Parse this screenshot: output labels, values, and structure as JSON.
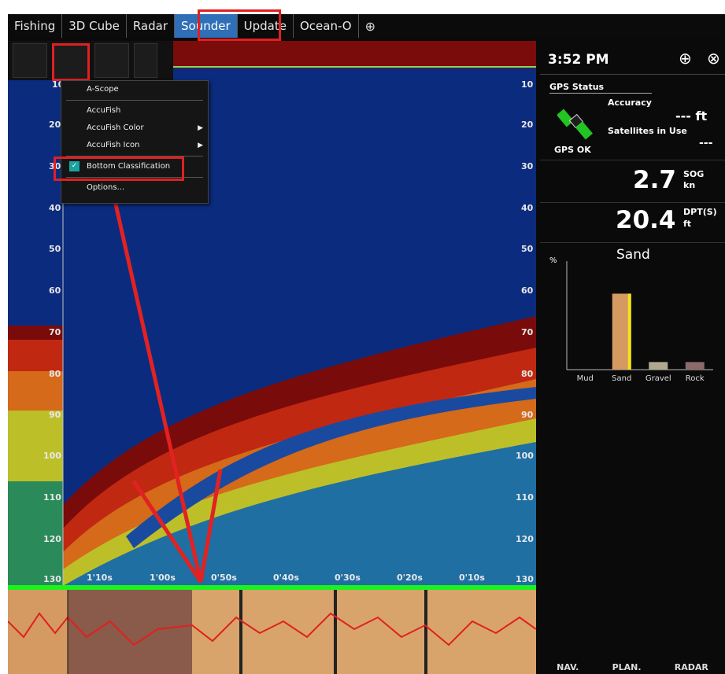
{
  "tabs": [
    {
      "label": "Fishing"
    },
    {
      "label": "3D Cube"
    },
    {
      "label": "Radar"
    },
    {
      "label": "Sounder"
    },
    {
      "label": "Update"
    },
    {
      "label": "Ocean-O"
    }
  ],
  "menu": {
    "items": [
      {
        "label": "A-Scope"
      },
      {
        "label": "AccuFish"
      },
      {
        "label": "AccuFish Color"
      },
      {
        "label": "AccuFish Icon"
      },
      {
        "label": "Bottom Classification"
      },
      {
        "label": "Options..."
      }
    ]
  },
  "sonar": {
    "depth_left": [
      "10",
      "20",
      "30",
      "40",
      "50",
      "60",
      "70",
      "80",
      "90",
      "100",
      "110",
      "120",
      "130"
    ],
    "depth_right": [
      "10",
      "20",
      "30",
      "40",
      "50",
      "60",
      "70",
      "80",
      "90",
      "100",
      "110",
      "120",
      "130"
    ],
    "time_labels": [
      "1'10s",
      "1'00s",
      "0'50s",
      "0'40s",
      "0'30s",
      "0'20s",
      "0'10s"
    ]
  },
  "panel": {
    "time": "3:52 PM",
    "gps_status_label": "GPS Status",
    "accuracy_label": "Accuracy",
    "accuracy_value": "---",
    "accuracy_unit": "ft",
    "sats_label": "Satellites in Use",
    "sats_value": "---",
    "gps_ok": "GPS OK",
    "sog_value": "2.7",
    "sog_label": "SOG",
    "sog_unit": "kn",
    "dpt_value": "20.4",
    "dpt_label": "DPT(S)",
    "dpt_unit": "ft",
    "bottom_title": "Sand",
    "pct_label": "%",
    "categories": [
      "Mud",
      "Sand",
      "Gravel",
      "Rock"
    ],
    "values": [
      0,
      70,
      7,
      7
    ]
  },
  "footer": {
    "items": [
      "NAV.",
      "PLAN.",
      "RADAR"
    ]
  },
  "colors": {
    "accent": "#2f6fb8",
    "highlight": "#e02020",
    "sonar_bg": "#0b2b7e",
    "bottom_line": "#1cf21c"
  }
}
